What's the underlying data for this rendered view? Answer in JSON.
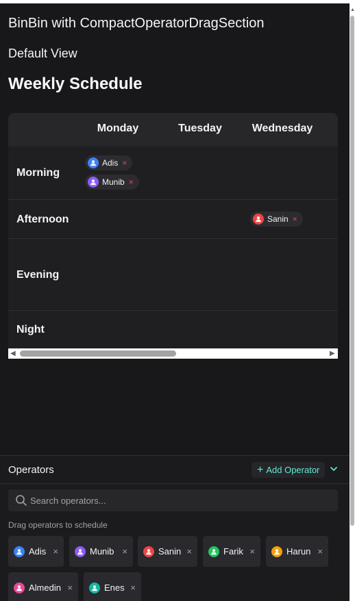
{
  "header": {
    "title": "BinBin with CompactOperatorDragSection",
    "view": "Default View",
    "schedule_title": "Weekly Schedule"
  },
  "schedule": {
    "days": [
      "Monday",
      "Tuesday",
      "Wednesday"
    ],
    "shifts": [
      "Morning",
      "Afternoon",
      "Evening",
      "Night"
    ],
    "assignments": {
      "morning_monday": [
        {
          "name": "Adis",
          "remove": "×",
          "color": "#3b82f6"
        },
        {
          "name": "Munib",
          "remove": "×",
          "color": "#8b5cf6"
        }
      ],
      "afternoon_wednesday": [
        {
          "name": "Sanin",
          "remove": "×",
          "color": "#ef4444"
        }
      ]
    }
  },
  "operators": {
    "title": "Operators",
    "add_label": "Add Operator",
    "search_placeholder": "Search operators...",
    "hint": "Drag operators to schedule",
    "list": [
      {
        "name": "Adis",
        "color": "#3b82f6",
        "remove": "×"
      },
      {
        "name": "Munib",
        "color": "#8b5cf6",
        "remove": "×"
      },
      {
        "name": "Sanin",
        "color": "#ef4444",
        "remove": "×"
      },
      {
        "name": "Farik",
        "color": "#22c55e",
        "remove": "×"
      },
      {
        "name": "Harun",
        "color": "#f59e0b",
        "remove": "×"
      },
      {
        "name": "Almedin",
        "color": "#ec4899",
        "remove": "×"
      },
      {
        "name": "Enes",
        "color": "#14b8a6",
        "remove": "×"
      }
    ]
  },
  "icons": {
    "avatar": "user-icon",
    "remove": "close-icon",
    "add": "plus-icon",
    "collapse": "chevron-down-icon",
    "search": "search-icon"
  }
}
